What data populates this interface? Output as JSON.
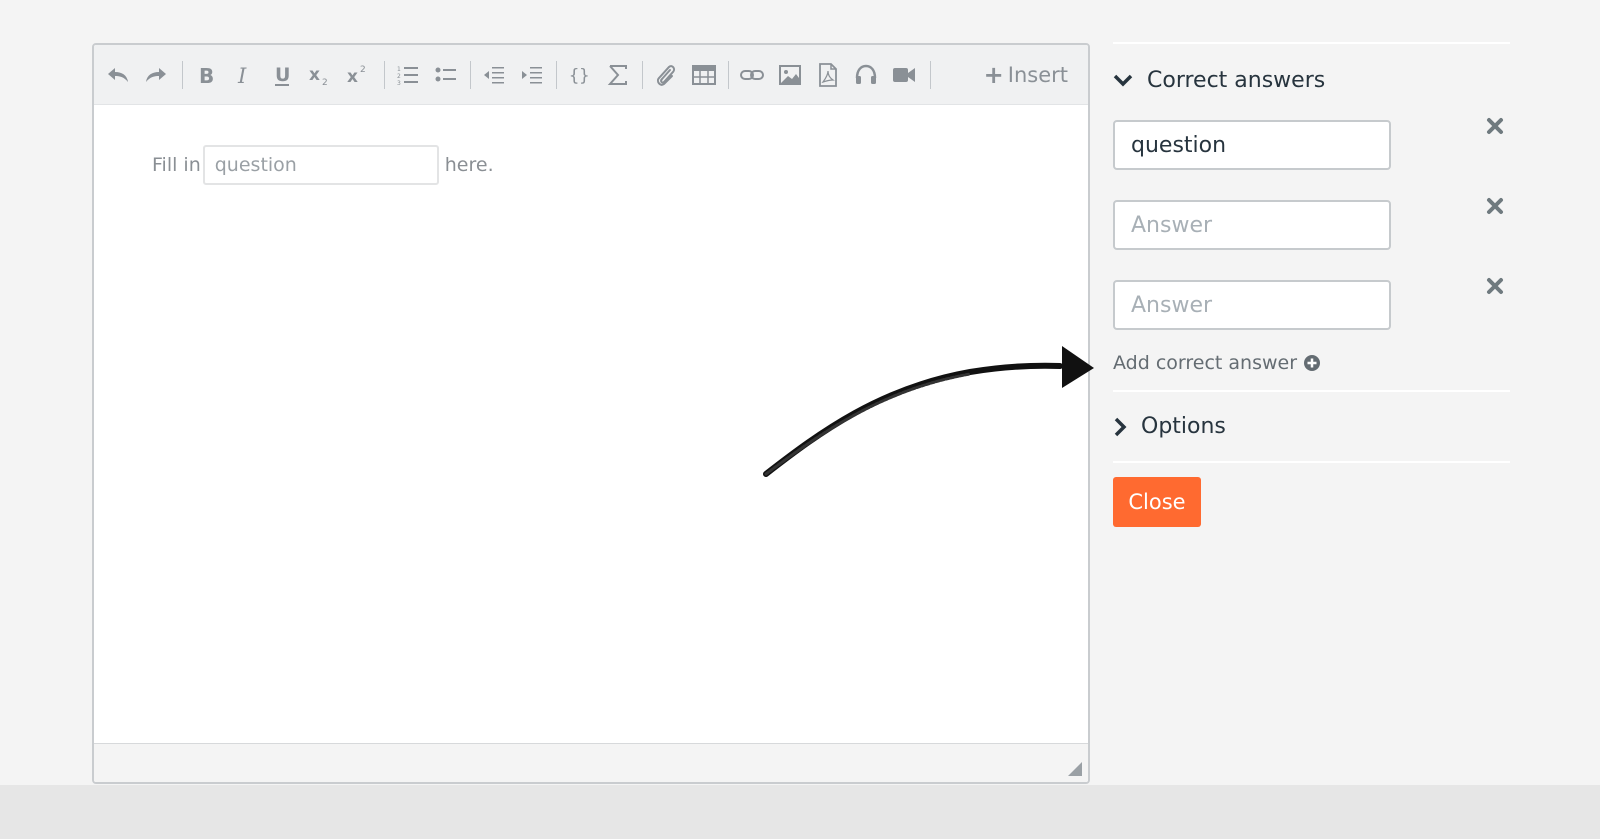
{
  "editor": {
    "toolbar": {
      "insert_label": "Insert",
      "buttons": [
        "undo-icon",
        "redo-icon",
        "bold-icon",
        "italic-icon",
        "underline-icon",
        "subscript-icon",
        "superscript-icon",
        "ordered-list-icon",
        "unordered-list-icon",
        "outdent-icon",
        "indent-icon",
        "curly-braces-icon",
        "sigma-icon",
        "paperclip-icon",
        "table-icon",
        "link-icon",
        "image-icon",
        "pdf-icon",
        "audio-icon",
        "video-icon"
      ]
    },
    "content": {
      "prefix": "Fill in",
      "gap_value": "question",
      "suffix": "here."
    }
  },
  "panel": {
    "correct_answers_title": "Correct answers",
    "answers": [
      {
        "value": "question",
        "placeholder": "Answer"
      },
      {
        "value": "",
        "placeholder": "Answer"
      },
      {
        "value": "",
        "placeholder": "Answer"
      }
    ],
    "add_answer_label": "Add correct answer",
    "options_title": "Options",
    "close_label": "Close"
  },
  "colors": {
    "accent": "#ff6a30",
    "text_dark": "#27343e",
    "icon_gray": "#8a9096",
    "remove_icon": "#6f7a7f"
  }
}
